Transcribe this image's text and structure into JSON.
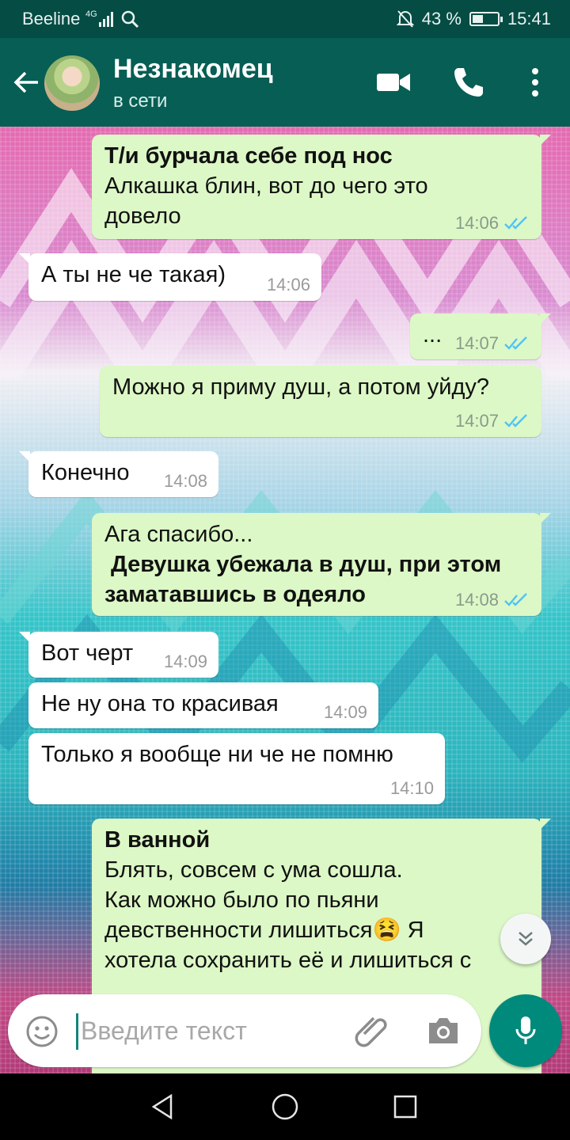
{
  "status_bar": {
    "carrier": "Beeline",
    "network": "4G",
    "battery_text": "43 %",
    "battery_level": 0.43,
    "time": "15:41"
  },
  "header": {
    "contact_name": "Незнакомец",
    "contact_status": "в сети",
    "icons": [
      "back-arrow-icon",
      "avatar",
      "video-call-icon",
      "phone-call-icon",
      "more-options-icon"
    ]
  },
  "messages": [
    {
      "dir": "out",
      "lines": [
        {
          "text": "Т/и бурчала себе под нос",
          "bold": true
        },
        {
          "text": "Алкашка блин, вот до чего это",
          "bold": false
        },
        {
          "text": "довело",
          "bold": false
        }
      ],
      "time": "14:06",
      "read": true
    },
    {
      "dir": "in",
      "lines": [
        {
          "text": "А ты не че такая)",
          "bold": false
        }
      ],
      "time": "14:06"
    },
    {
      "dir": "out",
      "lines": [
        {
          "text": "...",
          "bold": false
        }
      ],
      "time": "14:07",
      "read": true
    },
    {
      "dir": "out",
      "lines": [
        {
          "text": "Можно я приму душ, а потом уйду?",
          "bold": false
        }
      ],
      "time": "14:07",
      "read": true
    },
    {
      "dir": "in",
      "lines": [
        {
          "text": "Конечно",
          "bold": false
        }
      ],
      "time": "14:08"
    },
    {
      "dir": "out",
      "lines": [
        {
          "text": "Ага спасибо...",
          "bold": false
        },
        {
          "text": " Девушка убежала в душ, при этом",
          "bold": true
        },
        {
          "text": "заматавшись в одеяло",
          "bold": true
        }
      ],
      "time": "14:08",
      "read": true
    },
    {
      "dir": "in",
      "lines": [
        {
          "text": "Вот черт",
          "bold": false
        }
      ],
      "time": "14:09"
    },
    {
      "dir": "in",
      "lines": [
        {
          "text": "Не ну она то красивая",
          "bold": false
        }
      ],
      "time": "14:09"
    },
    {
      "dir": "in",
      "lines": [
        {
          "text": "Только я вообще ни че не помню",
          "bold": false
        }
      ],
      "time": "14:10"
    },
    {
      "dir": "out",
      "lines": [
        {
          "text": "В ванной",
          "bold": true
        },
        {
          "text": "Блять, совсем с ума сошла.",
          "bold": false
        },
        {
          "text": "Как можно было по пьяни",
          "bold": false
        },
        {
          "text": "девственности лишиться😫 Я",
          "bold": false
        },
        {
          "text": "хотела сохранить её и лишиться с",
          "bold": false
        }
      ],
      "time": "",
      "read": false
    }
  ],
  "input": {
    "placeholder": "Введите текст",
    "icons": [
      "emoji-icon",
      "attach-icon",
      "camera-icon",
      "microphone-icon"
    ]
  },
  "colors": {
    "header": "#075e54",
    "status_bar": "#054c44",
    "outgoing_bubble": "#dcf8c6",
    "incoming_bubble": "#ffffff",
    "read_ticks": "#4fc3f7",
    "mic_button": "#008a7c"
  }
}
